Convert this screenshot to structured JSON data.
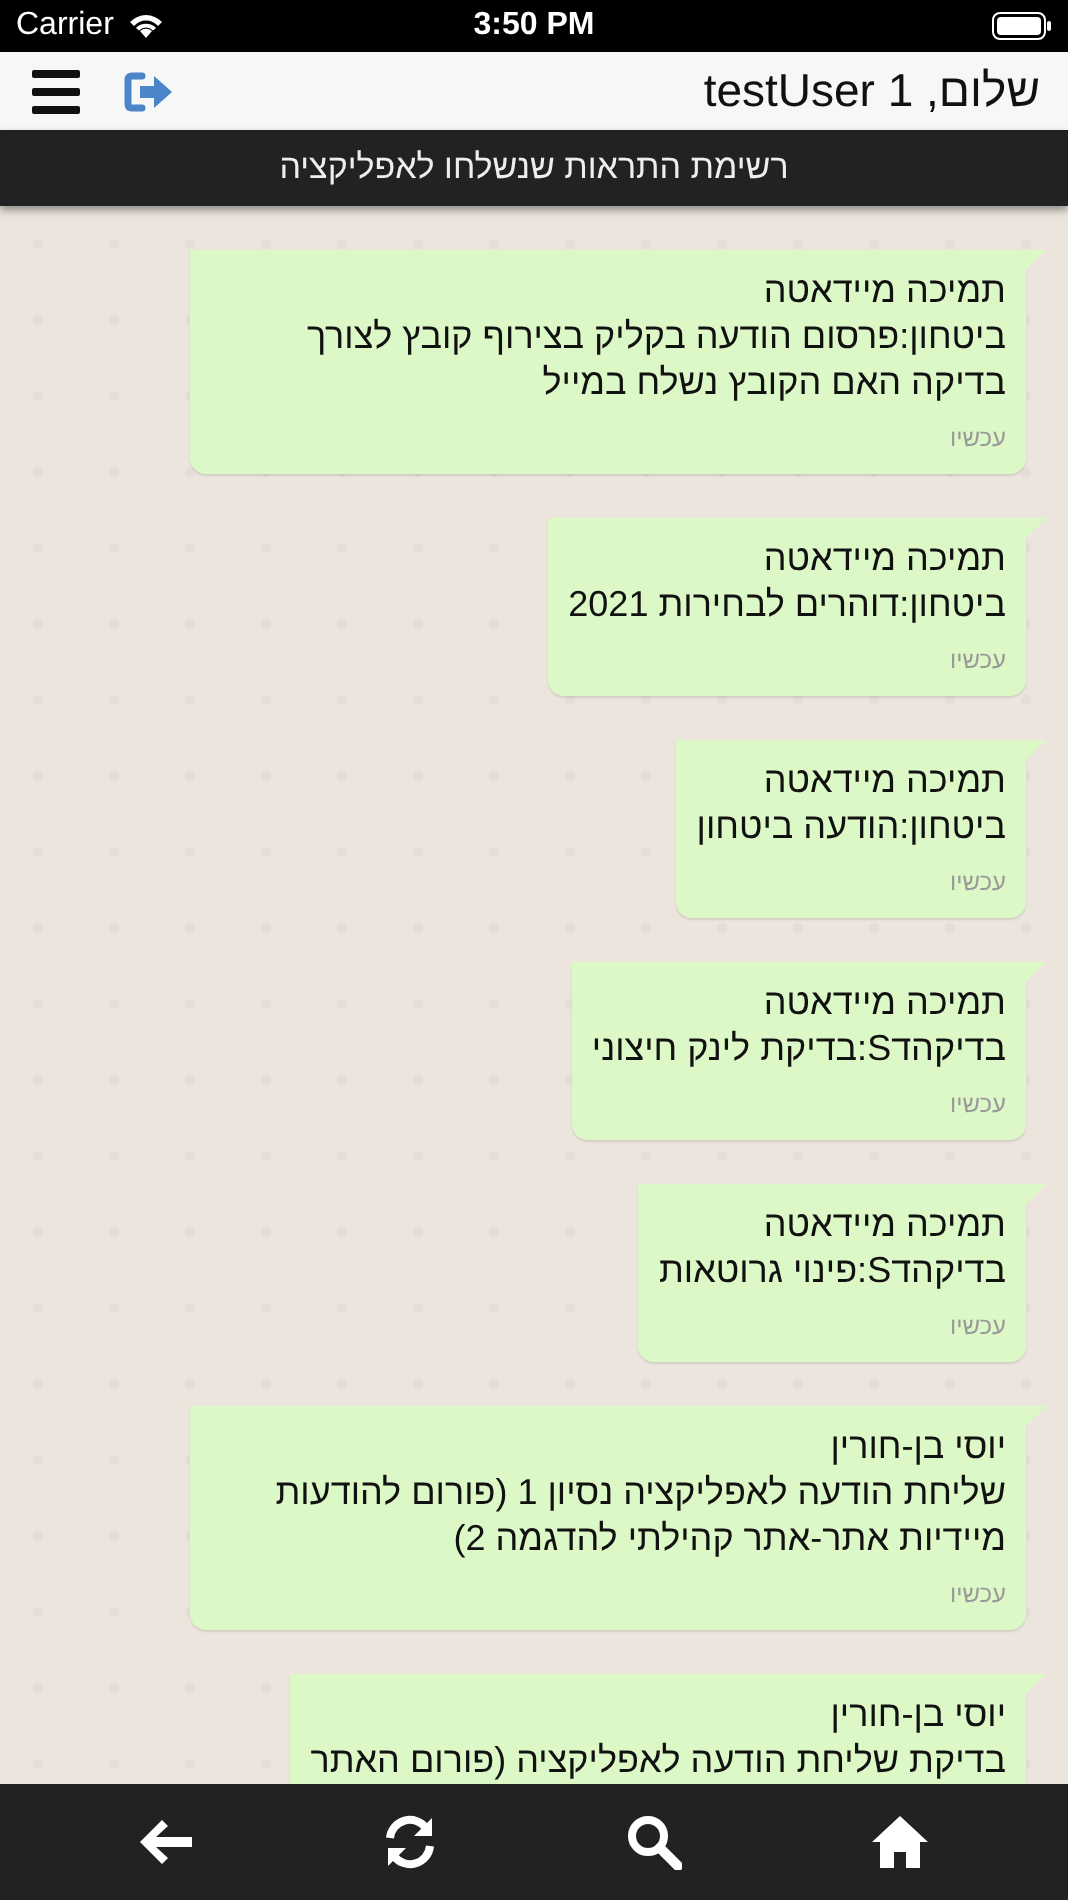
{
  "status_bar": {
    "carrier": "Carrier",
    "time": "3:50 PM"
  },
  "header": {
    "greeting": "שלום, testUser 1"
  },
  "title": "רשימת התראות שנשלחו לאפליקציה",
  "messages": [
    {
      "sender": "תמיכה מיידאטה",
      "body": "ביטחון:פרסום הודעה בקליק בצירוף קובץ לצורך בדיקה האם הקובץ נשלח במייל",
      "time": "עכשיו"
    },
    {
      "sender": "תמיכה מיידאטה",
      "body": "ביטחון:דוהרים לבחירות 2021",
      "time": "עכשיו"
    },
    {
      "sender": "תמיכה מיידאטה",
      "body": "ביטחון:הודעה ביטחון",
      "time": "עכשיו"
    },
    {
      "sender": "תמיכה מיידאטה",
      "body": "בדיקהדS:בדיקת לינק חיצוני",
      "time": "עכשיו"
    },
    {
      "sender": "תמיכה מיידאטה",
      "body": "בדיקהדS:פינוי גרוטאות",
      "time": "עכשיו"
    },
    {
      "sender": "יוסי בן-חורין",
      "body": "שליחת הודעה לאפליקציה נסיון 1 (פורום להודעות מיידיות אתר-אתר קהילתי להדגמה 2)",
      "time": "עכשיו"
    },
    {
      "sender": "יוסי בן-חורין",
      "body": "בדיקת שליחת הודעה לאפליקציה (פורום האתר"
    }
  ]
}
